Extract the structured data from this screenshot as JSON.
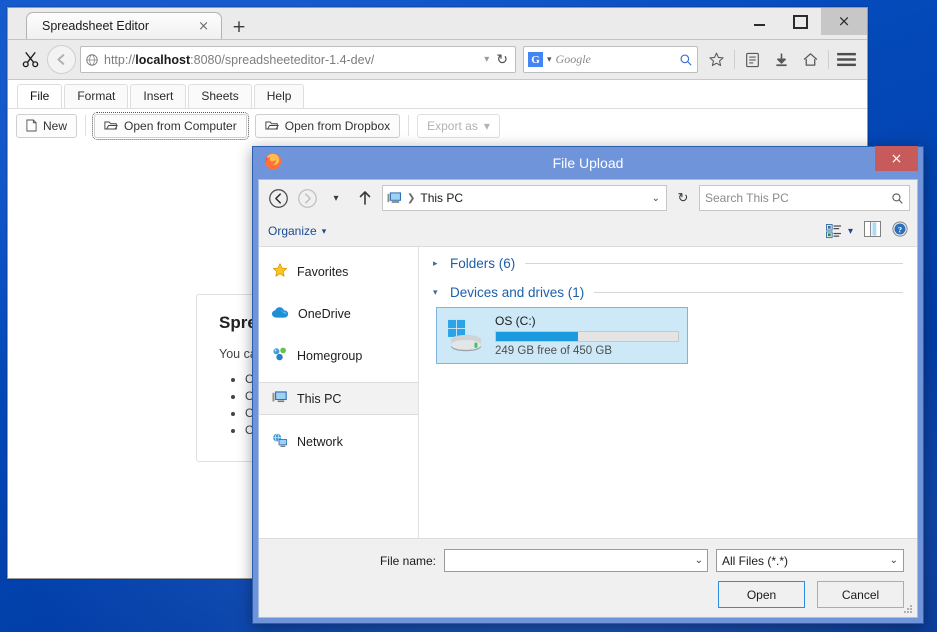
{
  "browser": {
    "tab": {
      "title": "Spreadsheet Editor",
      "close_glyph": "×"
    },
    "new_tab_glyph": "+",
    "url": {
      "scheme": "http://",
      "host": "localhost",
      "rest": ":8080/spreadsheeteditor-1.4-dev/"
    },
    "search": {
      "engine": "Google",
      "engine_letter": "G",
      "dropdown_glyph": "▾"
    },
    "reload_glyph": "↻",
    "window_controls": {
      "close_glyph": "×"
    },
    "icons": {
      "cut": "scissors-icon",
      "back": "back-arrow-icon",
      "bookmark": "star-icon",
      "reader": "reader-list-icon",
      "download": "download-arrow-icon",
      "home": "home-icon",
      "menu": "hamburger-menu-icon"
    }
  },
  "app": {
    "menu": [
      {
        "label": "File",
        "active": true
      },
      {
        "label": "Format",
        "active": false
      },
      {
        "label": "Insert",
        "active": false
      },
      {
        "label": "Sheets",
        "active": false
      },
      {
        "label": "Help",
        "active": false
      }
    ],
    "toolbar": {
      "new_label": "New",
      "open_computer_label": "Open from Computer",
      "open_dropbox_label": "Open from Dropbox",
      "export_label": "Export as",
      "export_caret": "▾"
    },
    "panel": {
      "heading": "Spreadsheet Editor",
      "intro": "You can ...",
      "bullets": [
        "Create a new spreadsheet",
        "Open a file from your computer",
        "Open a file from Dropbox",
        "Open a recent document"
      ]
    }
  },
  "dialog": {
    "title": "File Upload",
    "close_glyph": "×",
    "nav": {
      "back_glyph": "←",
      "forward_glyph": "→",
      "recent_caret": "▾",
      "up_glyph": "↑",
      "refresh_glyph": "↻",
      "crumb_sep": "❯",
      "crumb_dropdown": "⌄"
    },
    "breadcrumb": "This PC",
    "search_placeholder": "Search This PC",
    "toolbar": {
      "organize_label": "Organize",
      "organize_caret": "▾",
      "view_caret": "▾"
    },
    "sidebar": [
      {
        "label": "Favorites",
        "icon": "star-icon",
        "selected": false
      },
      {
        "label": "OneDrive",
        "icon": "cloud-icon",
        "selected": false
      },
      {
        "label": "Homegroup",
        "icon": "homegroup-icon",
        "selected": false
      },
      {
        "label": "This PC",
        "icon": "computer-icon",
        "selected": true
      },
      {
        "label": "Network",
        "icon": "network-icon",
        "selected": false
      }
    ],
    "groups": [
      {
        "title": "Folders (6)",
        "expanded": false,
        "arrow": "▸"
      },
      {
        "title": "Devices and drives (1)",
        "expanded": true,
        "arrow": "▾"
      }
    ],
    "drive": {
      "name": "OS (C:)",
      "free_text": "249 GB free of 450 GB",
      "used_percent": 45,
      "selected": true
    },
    "footer": {
      "file_name_label": "File name:",
      "file_name_value": "",
      "file_type_value": "All Files (*.*)",
      "open_label": "Open",
      "cancel_label": "Cancel",
      "caret": "⌄"
    }
  },
  "colors": {
    "desktop": "#0340ab",
    "dialog_frame": "#6f94d9",
    "dialog_close": "#c75b5b",
    "accent_blue": "#1c9ae0",
    "group_title": "#1c5fa8",
    "selection": "#cde8f7"
  }
}
